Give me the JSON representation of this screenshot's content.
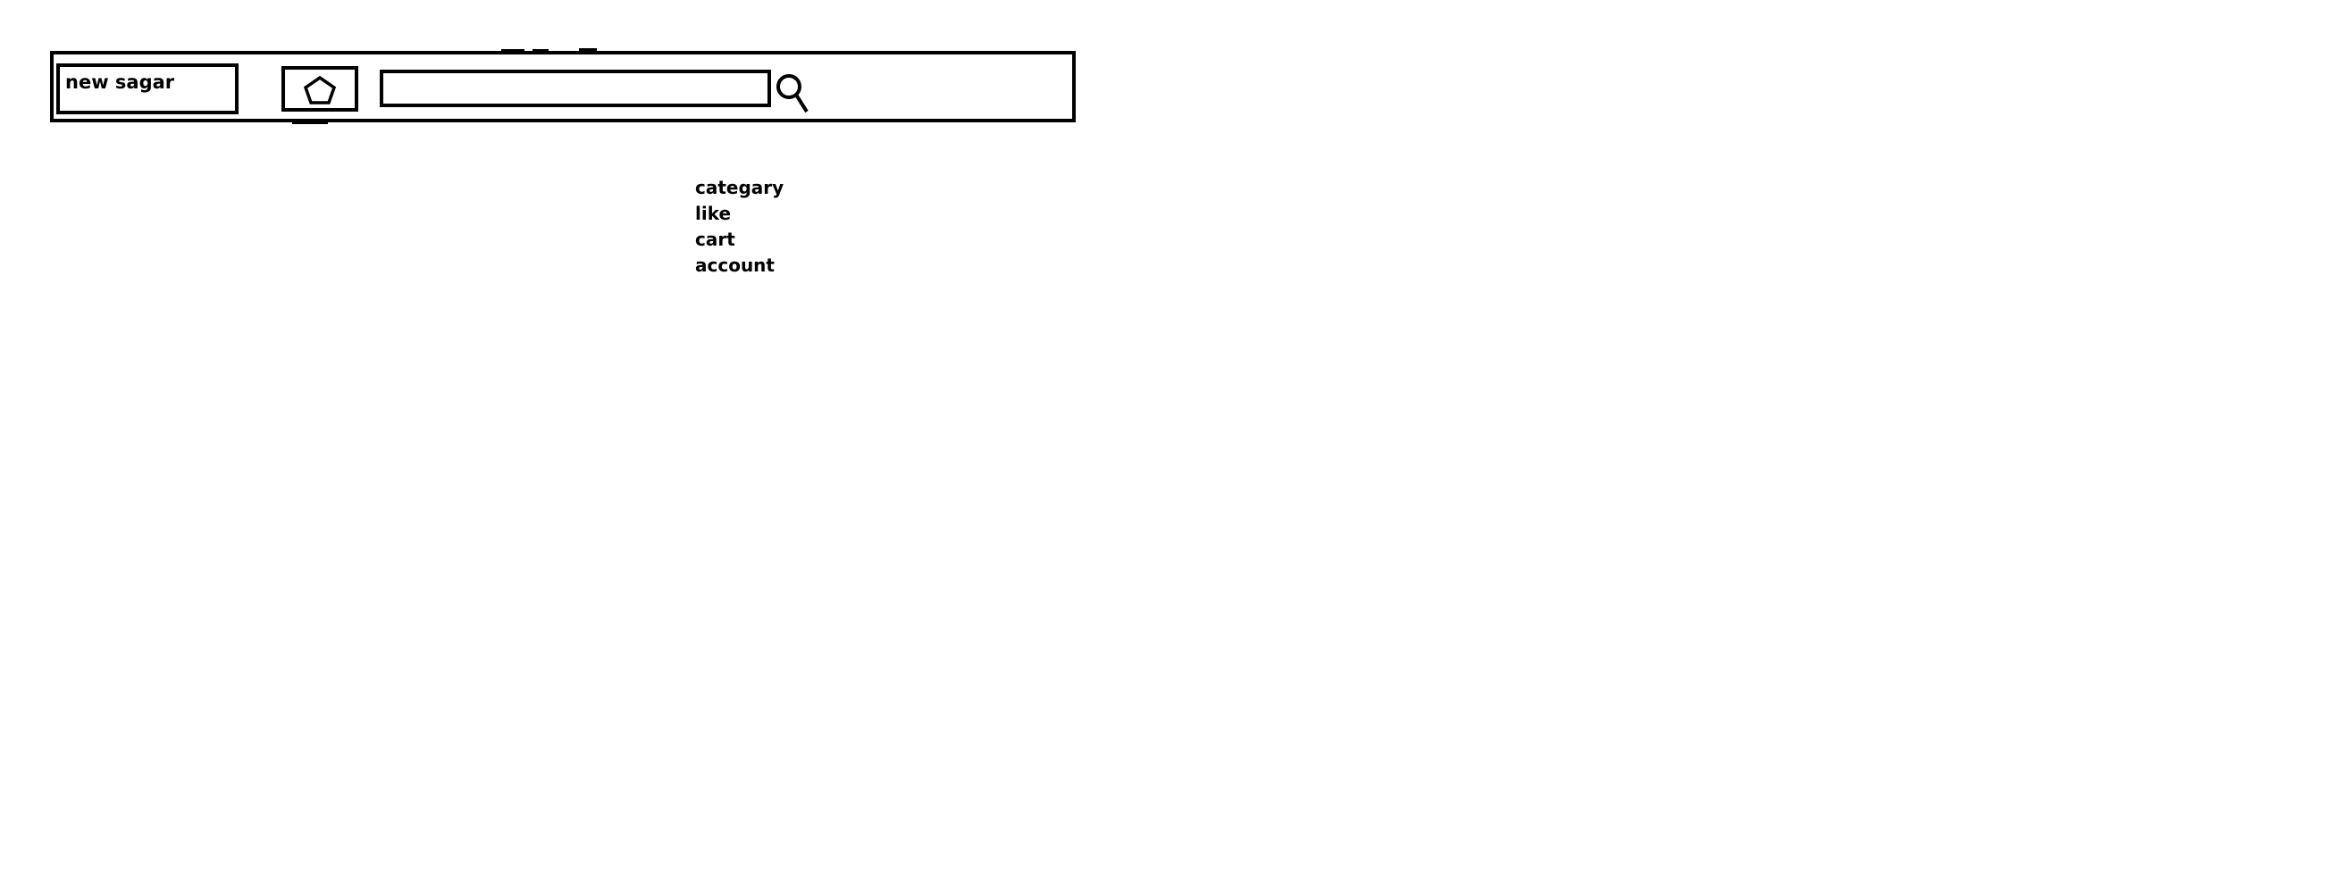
{
  "header": {
    "logo_text": "new sagar",
    "home_icon": "pentagon-icon",
    "search": {
      "value": "",
      "placeholder": "",
      "icon": "search-icon"
    }
  },
  "nav": {
    "items": [
      {
        "label": "categary"
      },
      {
        "label": "like"
      },
      {
        "label": "cart"
      },
      {
        "label": "account"
      }
    ]
  },
  "colors": {
    "stroke": "#000000",
    "background": "#ffffff"
  }
}
